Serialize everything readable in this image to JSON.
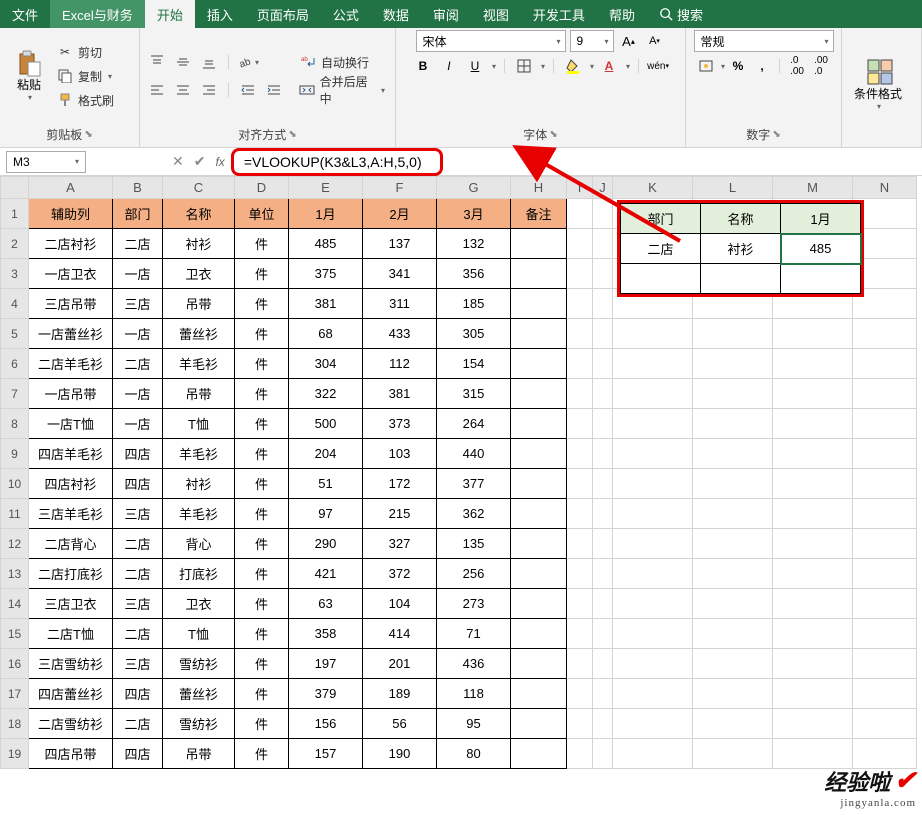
{
  "tabs": {
    "file": "文件",
    "custom": "Excel与财务",
    "home": "开始",
    "insert": "插入",
    "layout": "页面布局",
    "formula": "公式",
    "data": "数据",
    "review": "审阅",
    "view": "视图",
    "dev": "开发工具",
    "help": "帮助",
    "search": "搜索"
  },
  "ribbon": {
    "clipboard": {
      "paste": "粘贴",
      "cut": "剪切",
      "copy": "复制",
      "format_painter": "格式刷",
      "label": "剪贴板"
    },
    "align": {
      "wrap": "自动换行",
      "merge": "合并后居中",
      "label": "对齐方式"
    },
    "font": {
      "name": "宋体",
      "size": "9",
      "label": "字体",
      "bold": "B",
      "italic": "I",
      "underline": "U"
    },
    "number": {
      "format": "常规",
      "label": "数字"
    },
    "cond": {
      "label": "条件格式"
    }
  },
  "namebox": "M3",
  "formula": "=VLOOKUP(K3&L3,A:H,5,0)",
  "columns": [
    "A",
    "B",
    "C",
    "D",
    "E",
    "F",
    "G",
    "H",
    "I",
    "J",
    "K",
    "L",
    "M",
    "N"
  ],
  "header_row": [
    "辅助列",
    "部门",
    "名称",
    "单位",
    "1月",
    "2月",
    "3月",
    "备注"
  ],
  "rows": [
    [
      "二店衬衫",
      "二店",
      "衬衫",
      "件",
      "485",
      "137",
      "132",
      ""
    ],
    [
      "一店卫衣",
      "一店",
      "卫衣",
      "件",
      "375",
      "341",
      "356",
      ""
    ],
    [
      "三店吊带",
      "三店",
      "吊带",
      "件",
      "381",
      "311",
      "185",
      ""
    ],
    [
      "一店蕾丝衫",
      "一店",
      "蕾丝衫",
      "件",
      "68",
      "433",
      "305",
      ""
    ],
    [
      "二店羊毛衫",
      "二店",
      "羊毛衫",
      "件",
      "304",
      "112",
      "154",
      ""
    ],
    [
      "一店吊带",
      "一店",
      "吊带",
      "件",
      "322",
      "381",
      "315",
      ""
    ],
    [
      "一店T恤",
      "一店",
      "T恤",
      "件",
      "500",
      "373",
      "264",
      ""
    ],
    [
      "四店羊毛衫",
      "四店",
      "羊毛衫",
      "件",
      "204",
      "103",
      "440",
      ""
    ],
    [
      "四店衬衫",
      "四店",
      "衬衫",
      "件",
      "51",
      "172",
      "377",
      ""
    ],
    [
      "三店羊毛衫",
      "三店",
      "羊毛衫",
      "件",
      "97",
      "215",
      "362",
      ""
    ],
    [
      "二店背心",
      "二店",
      "背心",
      "件",
      "290",
      "327",
      "135",
      ""
    ],
    [
      "二店打底衫",
      "二店",
      "打底衫",
      "件",
      "421",
      "372",
      "256",
      ""
    ],
    [
      "三店卫衣",
      "三店",
      "卫衣",
      "件",
      "63",
      "104",
      "273",
      ""
    ],
    [
      "二店T恤",
      "二店",
      "T恤",
      "件",
      "358",
      "414",
      "71",
      ""
    ],
    [
      "三店雪纺衫",
      "三店",
      "雪纺衫",
      "件",
      "197",
      "201",
      "436",
      ""
    ],
    [
      "四店蕾丝衫",
      "四店",
      "蕾丝衫",
      "件",
      "379",
      "189",
      "118",
      ""
    ],
    [
      "二店雪纺衫",
      "二店",
      "雪纺衫",
      "件",
      "156",
      "56",
      "95",
      ""
    ],
    [
      "四店吊带",
      "四店",
      "吊带",
      "件",
      "157",
      "190",
      "80",
      ""
    ]
  ],
  "lookup": {
    "headers": [
      "部门",
      "名称",
      "1月"
    ],
    "row": [
      "二店",
      "衬衫",
      "485"
    ]
  },
  "watermark": {
    "main": "经验啦",
    "sub": "jingyanla.com"
  }
}
